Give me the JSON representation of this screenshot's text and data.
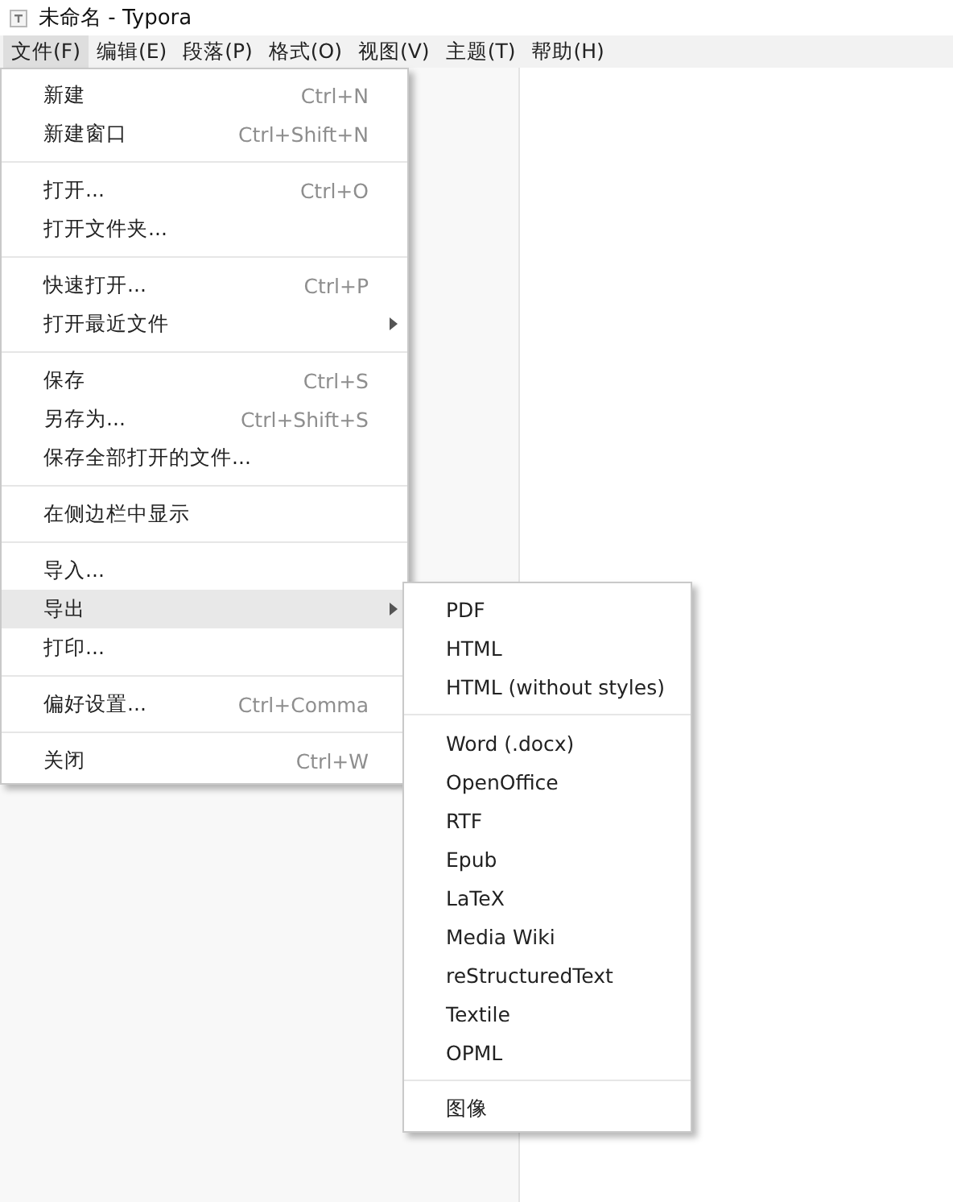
{
  "window": {
    "title": "未命名 - Typora"
  },
  "menubar": [
    {
      "label": "文件(F)",
      "selected": true
    },
    {
      "label": "编辑(E)",
      "selected": false
    },
    {
      "label": "段落(P)",
      "selected": false
    },
    {
      "label": "格式(O)",
      "selected": false
    },
    {
      "label": "视图(V)",
      "selected": false
    },
    {
      "label": "主题(T)",
      "selected": false
    },
    {
      "label": "帮助(H)",
      "selected": false
    }
  ],
  "file_menu": {
    "groups": [
      [
        {
          "label": "新建",
          "shortcut": "Ctrl+N",
          "has_submenu": false,
          "selected": false
        },
        {
          "label": "新建窗口",
          "shortcut": "Ctrl+Shift+N",
          "has_submenu": false,
          "selected": false
        }
      ],
      [
        {
          "label": "打开...",
          "shortcut": "Ctrl+O",
          "has_submenu": false,
          "selected": false
        },
        {
          "label": "打开文件夹...",
          "has_submenu": false,
          "selected": false
        }
      ],
      [
        {
          "label": "快速打开...",
          "shortcut": "Ctrl+P",
          "has_submenu": false,
          "selected": false
        },
        {
          "label": "打开最近文件",
          "has_submenu": true,
          "selected": false
        }
      ],
      [
        {
          "label": "保存",
          "shortcut": "Ctrl+S",
          "has_submenu": false,
          "selected": false
        },
        {
          "label": "另存为...",
          "shortcut": "Ctrl+Shift+S",
          "has_submenu": false,
          "selected": false
        },
        {
          "label": "保存全部打开的文件...",
          "has_submenu": false,
          "selected": false
        }
      ],
      [
        {
          "label": "在侧边栏中显示",
          "has_submenu": false,
          "selected": false
        }
      ],
      [
        {
          "label": "导入...",
          "has_submenu": false,
          "selected": false
        },
        {
          "label": "导出",
          "has_submenu": true,
          "selected": true
        },
        {
          "label": "打印...",
          "has_submenu": false,
          "selected": false
        }
      ],
      [
        {
          "label": "偏好设置...",
          "shortcut": "Ctrl+Comma",
          "has_submenu": false,
          "selected": false
        }
      ],
      [
        {
          "label": "关闭",
          "shortcut": "Ctrl+W",
          "has_submenu": false,
          "selected": false
        }
      ]
    ]
  },
  "export_submenu": {
    "groups": [
      [
        {
          "label": "PDF",
          "selected": false
        },
        {
          "label": "HTML",
          "selected": false
        },
        {
          "label": "HTML (without styles)",
          "selected": false
        }
      ],
      [
        {
          "label": "Word (.docx)",
          "selected": false
        },
        {
          "label": "OpenOffice",
          "selected": false
        },
        {
          "label": "RTF",
          "selected": false
        },
        {
          "label": "Epub",
          "selected": false
        },
        {
          "label": "LaTeX",
          "selected": false
        },
        {
          "label": "Media Wiki",
          "selected": false
        },
        {
          "label": "reStructuredText",
          "selected": false
        },
        {
          "label": "Textile",
          "selected": false
        },
        {
          "label": "OPML",
          "selected": false
        }
      ],
      [
        {
          "label": "图像",
          "selected": false
        }
      ]
    ]
  }
}
